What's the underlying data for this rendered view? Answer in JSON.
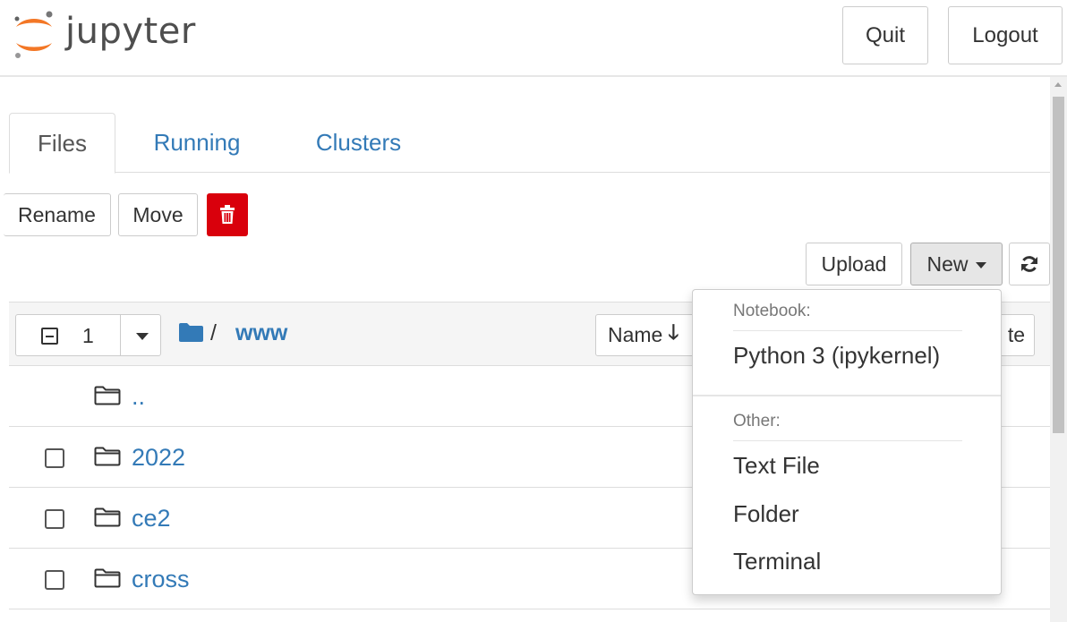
{
  "header": {
    "logo_text": "jupyter",
    "quit_label": "Quit",
    "logout_label": "Logout"
  },
  "tabs": [
    {
      "label": "Files",
      "active": true
    },
    {
      "label": "Running",
      "active": false
    },
    {
      "label": "Clusters",
      "active": false
    }
  ],
  "toolbar": {
    "rename_label": "Rename",
    "move_label": "Move",
    "delete_icon": "trash-icon",
    "upload_label": "Upload",
    "new_label": "New",
    "refresh_icon": "refresh-icon"
  },
  "list_header": {
    "selected_count": "1",
    "breadcrumb_slash": "/",
    "breadcrumb_folder": "www",
    "name_sort_label": "Name",
    "name_sort_arrow": "🡓",
    "date_sort_partial": "te"
  },
  "rows": [
    {
      "name": "..",
      "checkbox": false
    },
    {
      "name": "2022",
      "checkbox": true
    },
    {
      "name": "ce2",
      "checkbox": true
    },
    {
      "name": "cross",
      "checkbox": true
    }
  ],
  "new_menu": {
    "notebook_header": "Notebook:",
    "python_kernel": "Python 3 (ipykernel)",
    "other_header": "Other:",
    "text_file": "Text File",
    "folder": "Folder",
    "terminal": "Terminal"
  },
  "colors": {
    "accent_blue": "#337ab7",
    "delete_red": "#d9000c",
    "logo_orange": "#f37726"
  }
}
